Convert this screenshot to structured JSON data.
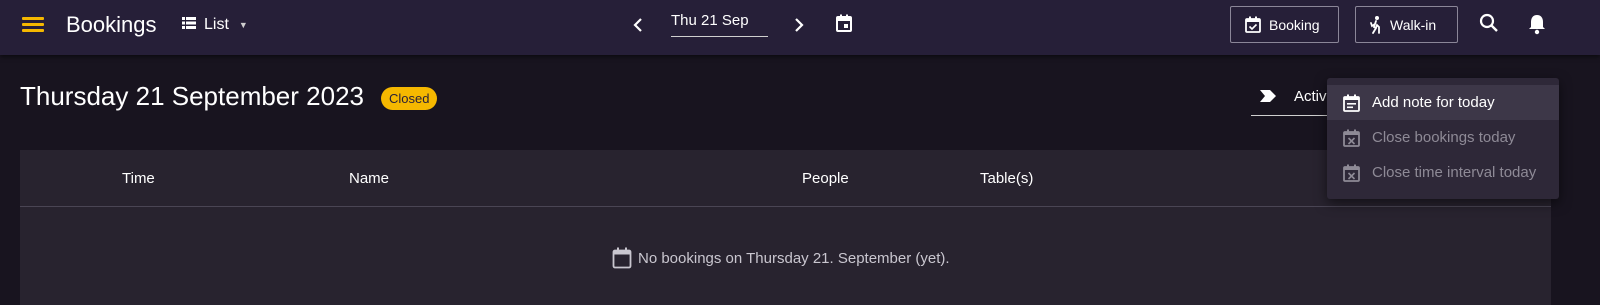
{
  "app": {
    "title": "Bookings"
  },
  "view_select": {
    "label": "List",
    "icon": "list-icon"
  },
  "date_nav": {
    "prev_icon": "chevron-left-icon",
    "current_date": "Thu 21 Sep",
    "next_icon": "chevron-right-icon",
    "calendar_icon": "calendar-icon"
  },
  "actions": {
    "booking_label": "Booking",
    "walkin_label": "Walk-in",
    "search_icon": "search-icon",
    "notifications_icon": "bell-icon"
  },
  "header": {
    "date_title": "Thursday 21 September 2023",
    "status_badge": "Closed",
    "status_filter": "Activ"
  },
  "table": {
    "columns": [
      "Time",
      "Name",
      "People",
      "Table(s)"
    ],
    "empty_message": "No bookings on Thursday 21. September (yet)."
  },
  "menu": {
    "items": [
      {
        "label": "Add note for today",
        "icon": "note-icon",
        "state": "active"
      },
      {
        "label": "Close bookings today",
        "icon": "calendar-close-icon",
        "state": "disabled"
      },
      {
        "label": "Close time interval today",
        "icon": "calendar-close-icon",
        "state": "disabled"
      }
    ]
  },
  "colors": {
    "topbar_bg": "#261f38",
    "page_bg": "#18141f",
    "accent": "#f5b800",
    "card_bg": "#28232f",
    "menu_bg": "#2e2838"
  }
}
